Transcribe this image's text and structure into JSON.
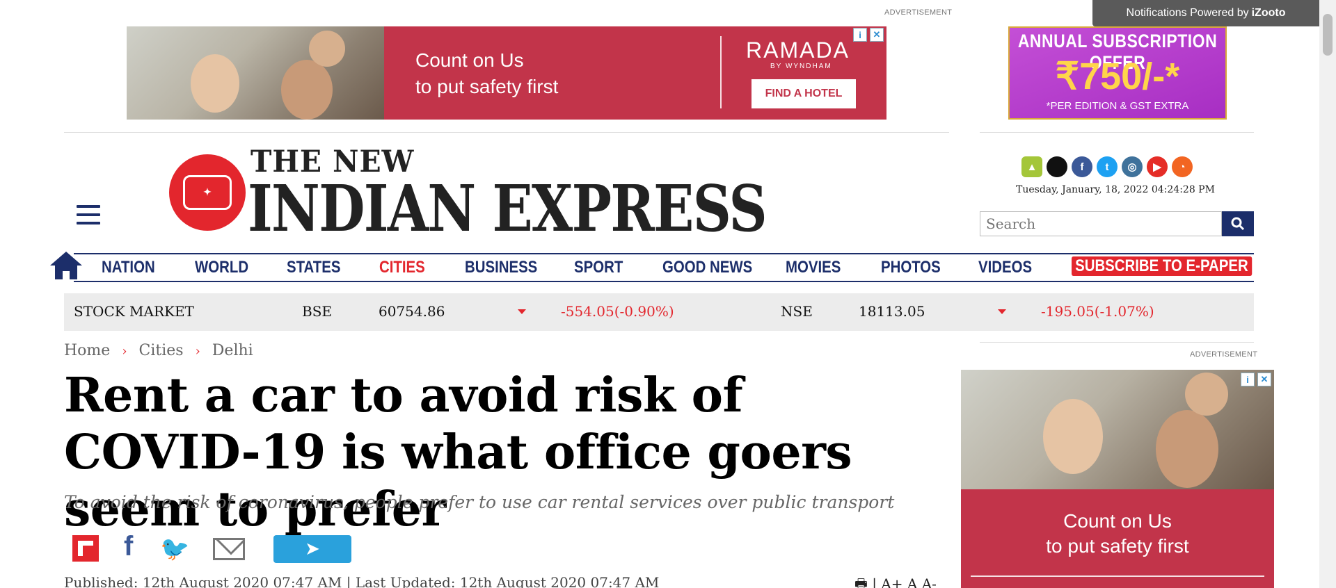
{
  "notifications": {
    "text": "Notifications Powered by ",
    "brand": "iZooto"
  },
  "top_ad": {
    "label": "ADVERTISEMENT",
    "line1": "Count on Us",
    "line2": "to put safety first",
    "brand": "RAMADA",
    "brand_sub": "BY WYNDHAM",
    "cta": "FIND A HOTEL"
  },
  "subscription_ad": {
    "line1": "ANNUAL SUBSCRIPTION OFFER",
    "price": "₹750/-*",
    "line3": "*PER EDITION & GST EXTRA"
  },
  "masthead": {
    "top": "THE NEW",
    "main": "INDIAN EXPRESS",
    "date": "Tuesday, January, 18, 2022  04:24:28 PM"
  },
  "search": {
    "placeholder": "Search"
  },
  "social_icons": [
    "android-icon",
    "apple-icon",
    "facebook-icon",
    "twitter-icon",
    "instagram-icon",
    "youtube-icon",
    "rss-icon"
  ],
  "nav": {
    "items": [
      "NATION",
      "WORLD",
      "STATES",
      "CITIES",
      "BUSINESS",
      "SPORT",
      "GOOD NEWS",
      "MOVIES",
      "PHOTOS",
      "VIDEOS"
    ],
    "active": "CITIES",
    "subscribe": "SUBSCRIBE TO E-PAPER"
  },
  "stock": {
    "label": "STOCK MARKET",
    "bse_label": "BSE",
    "bse_value": "60754.86",
    "bse_change": "-554.05(-0.90%)",
    "nse_label": "NSE",
    "nse_value": "18113.05",
    "nse_change": "-195.05(-1.07%)"
  },
  "breadcrumb": [
    "Home",
    "Cities",
    "Delhi"
  ],
  "article": {
    "title": "Rent a car to avoid risk of COVID-19 is what office goers seem to prefer",
    "standfirst": "To avoid the risk of coronavirus, people prefer to use car rental services over public transport",
    "meta": "Published: 12th August 2020 07:47 AM  |   Last Updated: 12th August 2020 07:47 AM",
    "tools": "🖶  |   A+  A   A-"
  },
  "side_ad": {
    "label": "ADVERTISEMENT",
    "line1": "Count on Us",
    "line2": "to put safety first"
  },
  "colors": {
    "brand_navy": "#1c2e6a",
    "brand_red": "#e3262d",
    "ad_red": "#c2344a"
  }
}
